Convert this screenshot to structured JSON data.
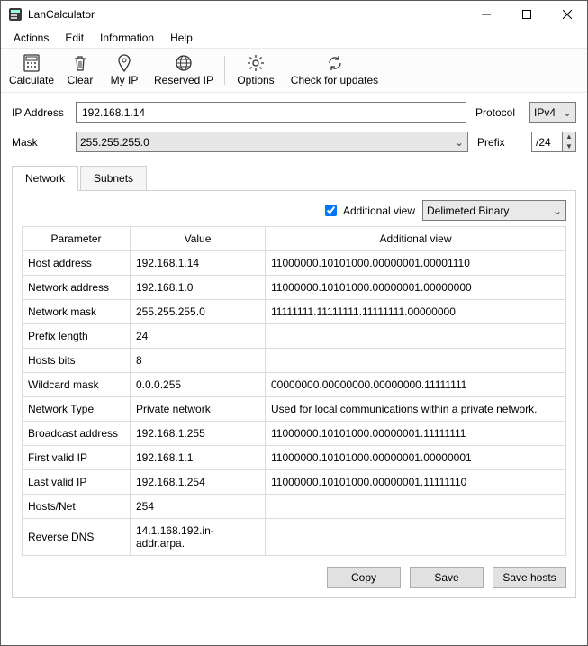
{
  "window": {
    "title": "LanCalculator"
  },
  "win_controls": {
    "min": "—",
    "max": "☐",
    "close": "✕"
  },
  "menu": {
    "actions": "Actions",
    "edit": "Edit",
    "information": "Information",
    "help": "Help"
  },
  "toolbar": {
    "calculate": "Calculate",
    "clear": "Clear",
    "myip": "My IP",
    "reserved": "Reserved IP",
    "options": "Options",
    "updates": "Check for updates"
  },
  "form": {
    "ip_label": "IP Address",
    "ip_value": "192.168.1.14",
    "protocol_label": "Protocol",
    "protocol_value": "IPv4",
    "mask_label": "Mask",
    "mask_value": "255.255.255.0",
    "prefix_label": "Prefix",
    "prefix_value": "/24"
  },
  "tabs": {
    "network": "Network",
    "subnets": "Subnets"
  },
  "additional_view": {
    "checkbox_label": "Additional view",
    "select_value": "Delimeted Binary",
    "checked": true
  },
  "columns": {
    "param": "Parameter",
    "value": "Value",
    "addl": "Additional view"
  },
  "rows": [
    {
      "param": "Host address",
      "value": "192.168.1.14",
      "addl": "11000000.10101000.00000001.00001110"
    },
    {
      "param": "Network address",
      "value": "192.168.1.0",
      "addl": "11000000.10101000.00000001.00000000"
    },
    {
      "param": "Network mask",
      "value": "255.255.255.0",
      "addl": "11111111.11111111.11111111.00000000"
    },
    {
      "param": "Prefix length",
      "value": "24",
      "addl": ""
    },
    {
      "param": "Hosts bits",
      "value": "8",
      "addl": ""
    },
    {
      "param": "Wildcard mask",
      "value": "0.0.0.255",
      "addl": "00000000.00000000.00000000.11111111"
    },
    {
      "param": "Network Type",
      "value": "Private network",
      "addl": "Used for local communications within a private network."
    },
    {
      "param": "Broadcast address",
      "value": "192.168.1.255",
      "addl": "11000000.10101000.00000001.11111111"
    },
    {
      "param": "First valid IP",
      "value": "192.168.1.1",
      "addl": "11000000.10101000.00000001.00000001"
    },
    {
      "param": "Last valid IP",
      "value": "192.168.1.254",
      "addl": "11000000.10101000.00000001.11111110"
    },
    {
      "param": "Hosts/Net",
      "value": "254",
      "addl": ""
    },
    {
      "param": "Reverse DNS",
      "value": "14.1.168.192.in-addr.arpa.",
      "addl": ""
    }
  ],
  "buttons": {
    "copy": "Copy",
    "save": "Save",
    "savehosts": "Save hosts"
  }
}
